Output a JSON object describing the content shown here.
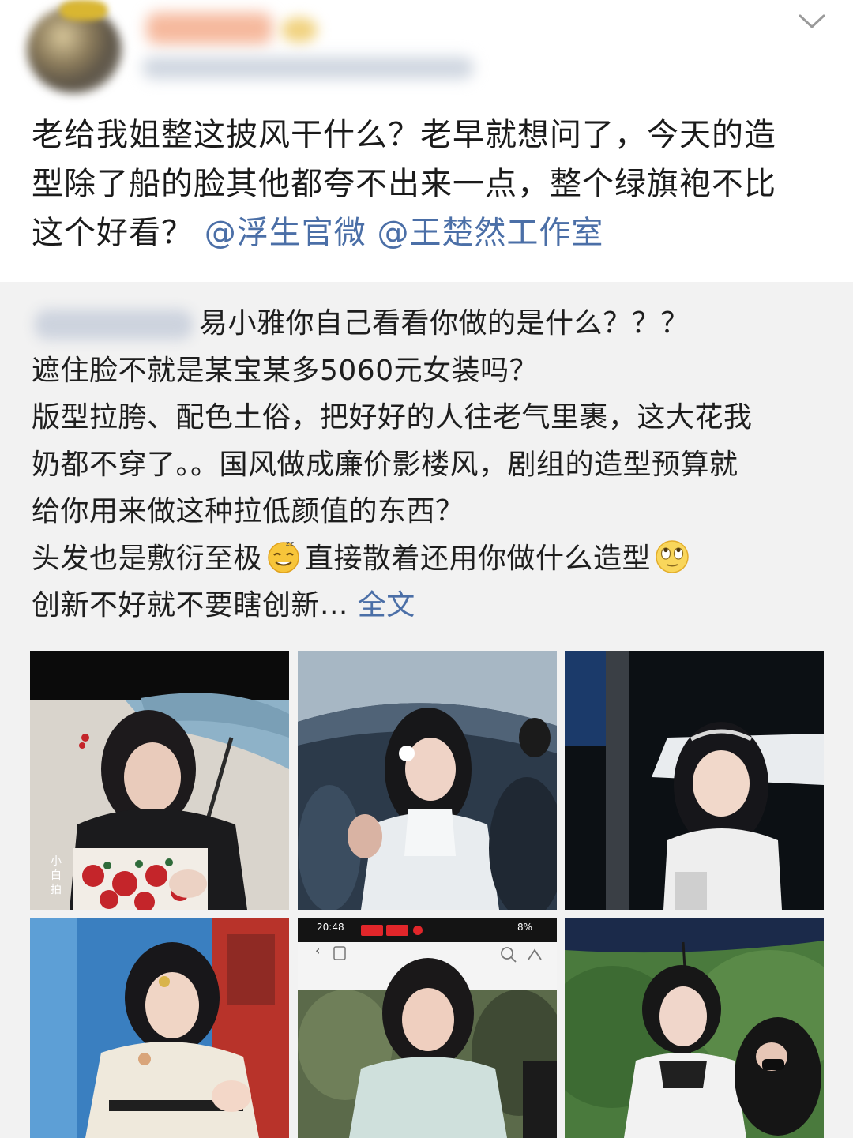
{
  "post": {
    "text_lines": [
      "老给我姐整这披风干什么？老早就想问了，今天的造",
      "型除了船的脸其他都夸不出来一点，整个绿旗袍不比",
      "这个好看？"
    ],
    "mentions": [
      "@浮生官微",
      "@王楚然工作室"
    ]
  },
  "repost": {
    "lines": [
      "易小雅你自己看看你做的是什么？？？",
      "遮住脸不就是某宝某多5060元女装吗？",
      "版型拉胯、配色土俗，把好好的人往老气里裹，这大花我",
      "奶都不穿了。。国风做成廉价影楼风，剧组的造型预算就",
      "给你用来做这种拉低颜值的东西？"
    ],
    "line6_part1": "头发也是敷衍至极",
    "line6_part2": "直接散着还用你做什么造型",
    "line7": "创新不好就不要瞎创新...",
    "full_text_link": "全文"
  },
  "photos": {
    "photo1_watermark": "小白拍",
    "photo5_status_time": "20:48",
    "photo5_status_battery": "8%"
  },
  "colors": {
    "mention": "#4b6fa7",
    "repost_bg": "#f2f2f2",
    "text": "#1b1b1b"
  },
  "icons": [
    "chevron-down-icon",
    "dizzy-face-emoji-icon",
    "rolling-eyes-emoji-icon"
  ]
}
